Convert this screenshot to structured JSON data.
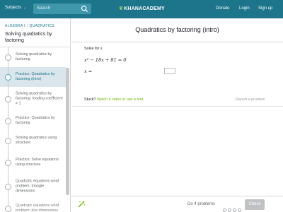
{
  "header": {
    "subjects_label": "Subjects",
    "search_placeholder": "Search",
    "logo_text": "KHANACADEMY",
    "donate_label": "Donate",
    "login_label": "Login",
    "signup_label": "Sign up",
    "bar_color": "#1c758a"
  },
  "sidebar": {
    "breadcrumb": [
      "ALGEBRA I",
      "QUADRATICS"
    ],
    "unit_title": "Solving quadratics by factoring",
    "items": [
      {
        "label": "Solving quadratics by factoring",
        "active": false
      },
      {
        "label": "Practice: Quadratics by factoring (intro)",
        "active": true
      },
      {
        "label": "Solving quadratics by factoring: leading coefficient ≠ 1",
        "active": false
      },
      {
        "label": "Practice: Quadratics by factoring",
        "active": false
      },
      {
        "label": "Solving quadratics using structure",
        "active": false
      },
      {
        "label": "Practice: Solve equations using structure",
        "active": false
      },
      {
        "label": "Quadratic equations word problem: triangle dimensions",
        "active": false
      },
      {
        "label": "Quadratic equations word problem: box dimensions",
        "active": false
      }
    ]
  },
  "main": {
    "title": "Quadratics by factoring (intro)",
    "prompt": "Solve for x.",
    "equation": "x² − 18x + 81 = 0",
    "answer_label": "x =",
    "answer_value": "",
    "stuck_label": "Stuck?",
    "stuck_link": "Watch a video or use a hint.",
    "report_label": "Report a problem"
  },
  "footer": {
    "do_problems": "Do 4 problems",
    "problem_dots": 4,
    "check_label": "Check"
  }
}
